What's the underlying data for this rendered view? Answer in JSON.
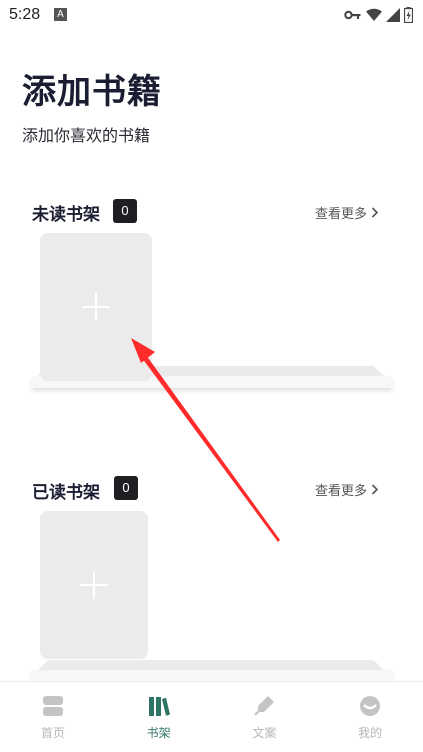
{
  "status_bar": {
    "time": "5:28",
    "notif_glyph": "A"
  },
  "header": {
    "title": "添加书籍",
    "subtitle": "添加你喜欢的书籍"
  },
  "unread_shelf": {
    "title": "未读书架",
    "count": "0",
    "see_more": "查看更多"
  },
  "read_shelf": {
    "title": "已读书架",
    "count": "0",
    "see_more": "查看更多"
  },
  "tabs": [
    {
      "label": "首页",
      "icon": "home-icon",
      "active": false
    },
    {
      "label": "书架",
      "icon": "bookshelf-icon",
      "active": true
    },
    {
      "label": "文案",
      "icon": "pen-icon",
      "active": false
    },
    {
      "label": "我的",
      "icon": "profile-icon",
      "active": false
    }
  ],
  "colors": {
    "accent": "#2f7565",
    "inactive": "#b6b6b6",
    "badge": "#1d1f22",
    "annotation_arrow": "#ff2a2a"
  }
}
